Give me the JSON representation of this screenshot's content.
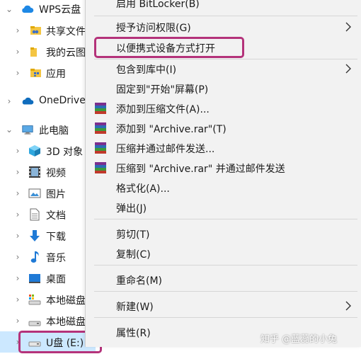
{
  "nav": {
    "items": [
      {
        "label": "WPS云盘",
        "icon": "cloud-icon"
      },
      {
        "label": "共享文件",
        "icon": "shared-folder-icon"
      },
      {
        "label": "我的云图",
        "icon": "folder-icon"
      },
      {
        "label": "应用",
        "icon": "app-folder-icon"
      },
      {
        "label": "OneDrive",
        "icon": "onedrive-icon"
      },
      {
        "label": "此电脑",
        "icon": "this-pc-icon"
      },
      {
        "label": "3D 对象",
        "icon": "3d-objects-icon"
      },
      {
        "label": "视频",
        "icon": "video-icon"
      },
      {
        "label": "图片",
        "icon": "pictures-icon"
      },
      {
        "label": "文档",
        "icon": "documents-icon"
      },
      {
        "label": "下载",
        "icon": "downloads-icon"
      },
      {
        "label": "音乐",
        "icon": "music-icon"
      },
      {
        "label": "桌面",
        "icon": "desktop-icon"
      },
      {
        "label": "本地磁盘",
        "icon": "local-disk-icon"
      },
      {
        "label": "本地磁盘",
        "icon": "local-disk-icon"
      },
      {
        "label": "U盘 (E:)",
        "icon": "usb-drive-icon"
      }
    ]
  },
  "menu": {
    "items": [
      {
        "label": "启用 BitLocker(B)"
      },
      {
        "label": "授予访问权限(G)",
        "submenu": true
      },
      {
        "label": "以便携式设备方式打开"
      },
      {
        "label": "包含到库中(I)",
        "submenu": true
      },
      {
        "label": "固定到\"开始\"屏幕(P)"
      },
      {
        "label": "添加到压缩文件(A)...",
        "icon": "winrar-icon"
      },
      {
        "label": "添加到 \"Archive.rar\"(T)",
        "icon": "winrar-icon"
      },
      {
        "label": "压缩并通过邮件发送...",
        "icon": "winrar-icon"
      },
      {
        "label": "压缩到 \"Archive.rar\" 并通过邮件发送",
        "icon": "winrar-icon"
      },
      {
        "label": "格式化(A)..."
      },
      {
        "label": "弹出(J)"
      },
      {
        "label": "剪切(T)"
      },
      {
        "label": "复制(C)"
      },
      {
        "label": "重命名(M)"
      },
      {
        "label": "新建(W)",
        "submenu": true
      },
      {
        "label": "属性(R)"
      }
    ]
  },
  "watermark": "知乎 @蓝蕊的小兔",
  "colors": {
    "menu_bg": "#f2f2f2",
    "highlight_border": "#b4327a",
    "selection": "#cce8ff"
  }
}
